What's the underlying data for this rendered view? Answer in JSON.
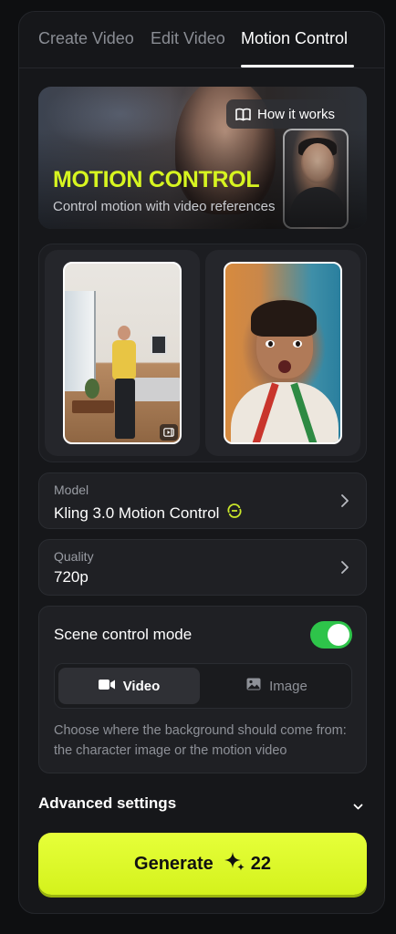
{
  "tabs": [
    {
      "label": "Create Video",
      "active": false
    },
    {
      "label": "Edit Video",
      "active": false
    },
    {
      "label": "Motion Control",
      "active": true
    }
  ],
  "hero": {
    "title": "MOTION CONTROL",
    "subtitle": "Control motion with video references",
    "how_it_works_label": "How it works",
    "how_it_works_icon": "book-open-icon",
    "accent_color": "#d7f520"
  },
  "media": {
    "motion_video": {
      "icon": "video-badge-icon"
    },
    "character_image": {}
  },
  "model": {
    "label": "Model",
    "value": "Kling 3.0 Motion Control",
    "badge_icon": "kling-logo-icon"
  },
  "quality": {
    "label": "Quality",
    "value": "720p"
  },
  "scene_control": {
    "title": "Scene control mode",
    "enabled": true,
    "toggle_color": "#2ec44a",
    "options": [
      {
        "label": "Video",
        "icon": "video-camera-icon",
        "selected": true
      },
      {
        "label": "Image",
        "icon": "image-icon",
        "selected": false
      }
    ],
    "help_text": "Choose where the background should come from: the character image or the motion video"
  },
  "advanced": {
    "label": "Advanced settings",
    "expanded": false
  },
  "generate": {
    "label": "Generate",
    "credits": "22",
    "credits_icon": "sparkle-icon",
    "color": "#dcfa2a"
  }
}
